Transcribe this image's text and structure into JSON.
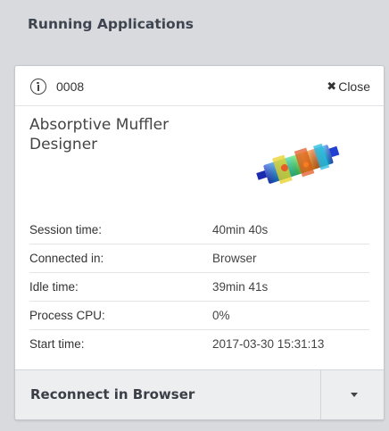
{
  "panel": {
    "title": "Running Applications"
  },
  "card": {
    "id": "0008",
    "close_label": "Close",
    "close_glyph": "✖",
    "app_name": "Absorptive Muffler Designer",
    "thumbnail": "muffler-simulation-thumbnail",
    "details": [
      {
        "label": "Session time:",
        "value": "40min 40s"
      },
      {
        "label": "Connected in:",
        "value": "Browser"
      },
      {
        "label": "Idle time:",
        "value": "39min 41s"
      },
      {
        "label": "Process CPU:",
        "value": "0%"
      },
      {
        "label": "Start time:",
        "value": "2017-03-30 15:31:13"
      }
    ],
    "footer": {
      "reconnect_label": "Reconnect in Browser"
    }
  },
  "colors": {
    "background": "#d8dadd",
    "card": "#ffffff",
    "footer": "#eceeef"
  }
}
